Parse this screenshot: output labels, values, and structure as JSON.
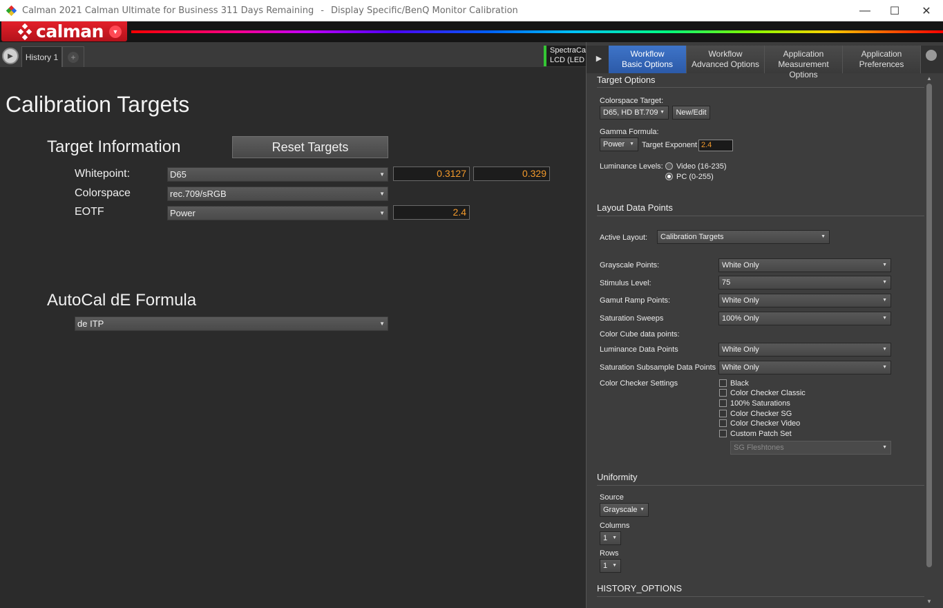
{
  "window": {
    "app_title": "Calman 2021 Calman Ultimate for Business 311 Days Remaining",
    "separator": "-",
    "doc_title": "Display Specific/BenQ Monitor Calibration",
    "minimize": "—",
    "maximize": "☐",
    "close": "✕"
  },
  "brand": {
    "wordmark": "calman",
    "menu_caret": "▼"
  },
  "tabs": {
    "play": "▶",
    "history_tab": "History 1",
    "add": "+",
    "device_line1": "SpectraCal",
    "device_line2": "LCD (LED B"
  },
  "main": {
    "page_title": "Calibration Targets",
    "target_info_heading": "Target Information",
    "reset_button": "Reset Targets",
    "whitepoint": {
      "label": "Whitepoint:",
      "value": "D65",
      "x": "0.3127",
      "y": "0.329"
    },
    "colorspace": {
      "label": "Colorspace",
      "value": "rec.709/sRGB"
    },
    "eotf": {
      "label": "EOTF",
      "value": "Power",
      "exponent": "2.4"
    },
    "autocal_heading": "AutoCal dE Formula",
    "autocal_value": "de ITP"
  },
  "panel": {
    "play": "▶",
    "tabs": [
      {
        "line1": "Workflow",
        "line2": "Basic Options",
        "active": true
      },
      {
        "line1": "Workflow",
        "line2": "Advanced Options",
        "active": false
      },
      {
        "line1": "Application",
        "line2": "Measurement Options",
        "active": false
      },
      {
        "line1": "Application",
        "line2": "Preferences",
        "active": false
      }
    ],
    "target_options": {
      "title": "Target Options",
      "colorspace_label": "Colorspace Target:",
      "colorspace_value": "D65, HD BT.709",
      "new_edit": "New/Edit",
      "gamma_label": "Gamma Formula:",
      "gamma_value": "Power",
      "target_exponent_label": "Target Exponent",
      "target_exponent_value": "2.4",
      "luminance_label": "Luminance Levels:",
      "luminance_video": "Video (16-235)",
      "luminance_pc": "PC (0-255)",
      "luminance_selected": "PC (0-255)"
    },
    "layout_data_points": {
      "title": "Layout Data Points",
      "active_layout_label": "Active Layout:",
      "active_layout_value": "Calibration Targets",
      "grayscale_label": "Grayscale Points:",
      "grayscale_value": "White Only",
      "stimulus_label": "Stimulus Level:",
      "stimulus_value": "75",
      "gamut_label": "Gamut Ramp Points:",
      "gamut_value": "White Only",
      "saturation_label": "Saturation Sweeps",
      "saturation_value": "100% Only",
      "color_cube_label": "Color Cube data points:",
      "luminance_dp_label": "Luminance Data Points",
      "luminance_dp_value": "White Only",
      "sat_subsample_label": "Saturation Subsample Data Points",
      "sat_subsample_value": "White Only",
      "color_checker_label": "Color Checker Settings",
      "checkers": [
        "Black",
        "Color Checker Classic",
        "100% Saturations",
        "Color Checker SG",
        "Color Checker Video",
        "Custom Patch Set"
      ],
      "custom_patch_value": "SG Fleshtones"
    },
    "uniformity": {
      "title": "Uniformity",
      "source_label": "Source",
      "source_value": "Grayscale",
      "columns_label": "Columns",
      "columns_value": "1",
      "rows_label": "Rows",
      "rows_value": "1"
    },
    "history_options": {
      "title": "HISTORY_OPTIONS"
    }
  },
  "colors": {
    "accent_orange": "#f39a2c",
    "active_tab_blue": "#3e74c8",
    "brand_red": "#e3202a",
    "device_green": "#34c634"
  }
}
